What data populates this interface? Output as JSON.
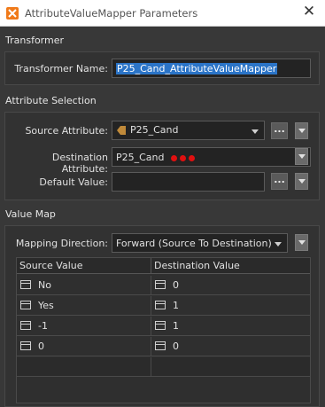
{
  "window": {
    "title": "AttributeValueMapper Parameters",
    "close_glyph": "✕"
  },
  "transformer": {
    "section_title": "Transformer",
    "name_label": "Transformer Name:",
    "name_value": "P25_Cand_AttributeValueMapper"
  },
  "attribute_selection": {
    "section_title": "Attribute Selection",
    "source_label": "Source Attribute:",
    "source_value": "P25_Cand",
    "destination_label": "Destination Attribute:",
    "destination_value": "P25_Cand",
    "default_label": "Default Value:",
    "default_value": "",
    "ellipsis": "..."
  },
  "value_map": {
    "section_title": "Value Map",
    "direction_label": "Mapping Direction:",
    "direction_value": "Forward (Source To Destination)",
    "columns": [
      "Source Value",
      "Destination Value"
    ],
    "rows": [
      {
        "source": "No",
        "destination": "0"
      },
      {
        "source": "Yes",
        "destination": "1"
      },
      {
        "source": "-1",
        "destination": "1"
      },
      {
        "source": "0",
        "destination": "0"
      }
    ]
  },
  "colors": {
    "background": "#383838",
    "selection": "#2b74c7",
    "required_dot": "#e01010",
    "source_icon": "#c08a3a"
  }
}
